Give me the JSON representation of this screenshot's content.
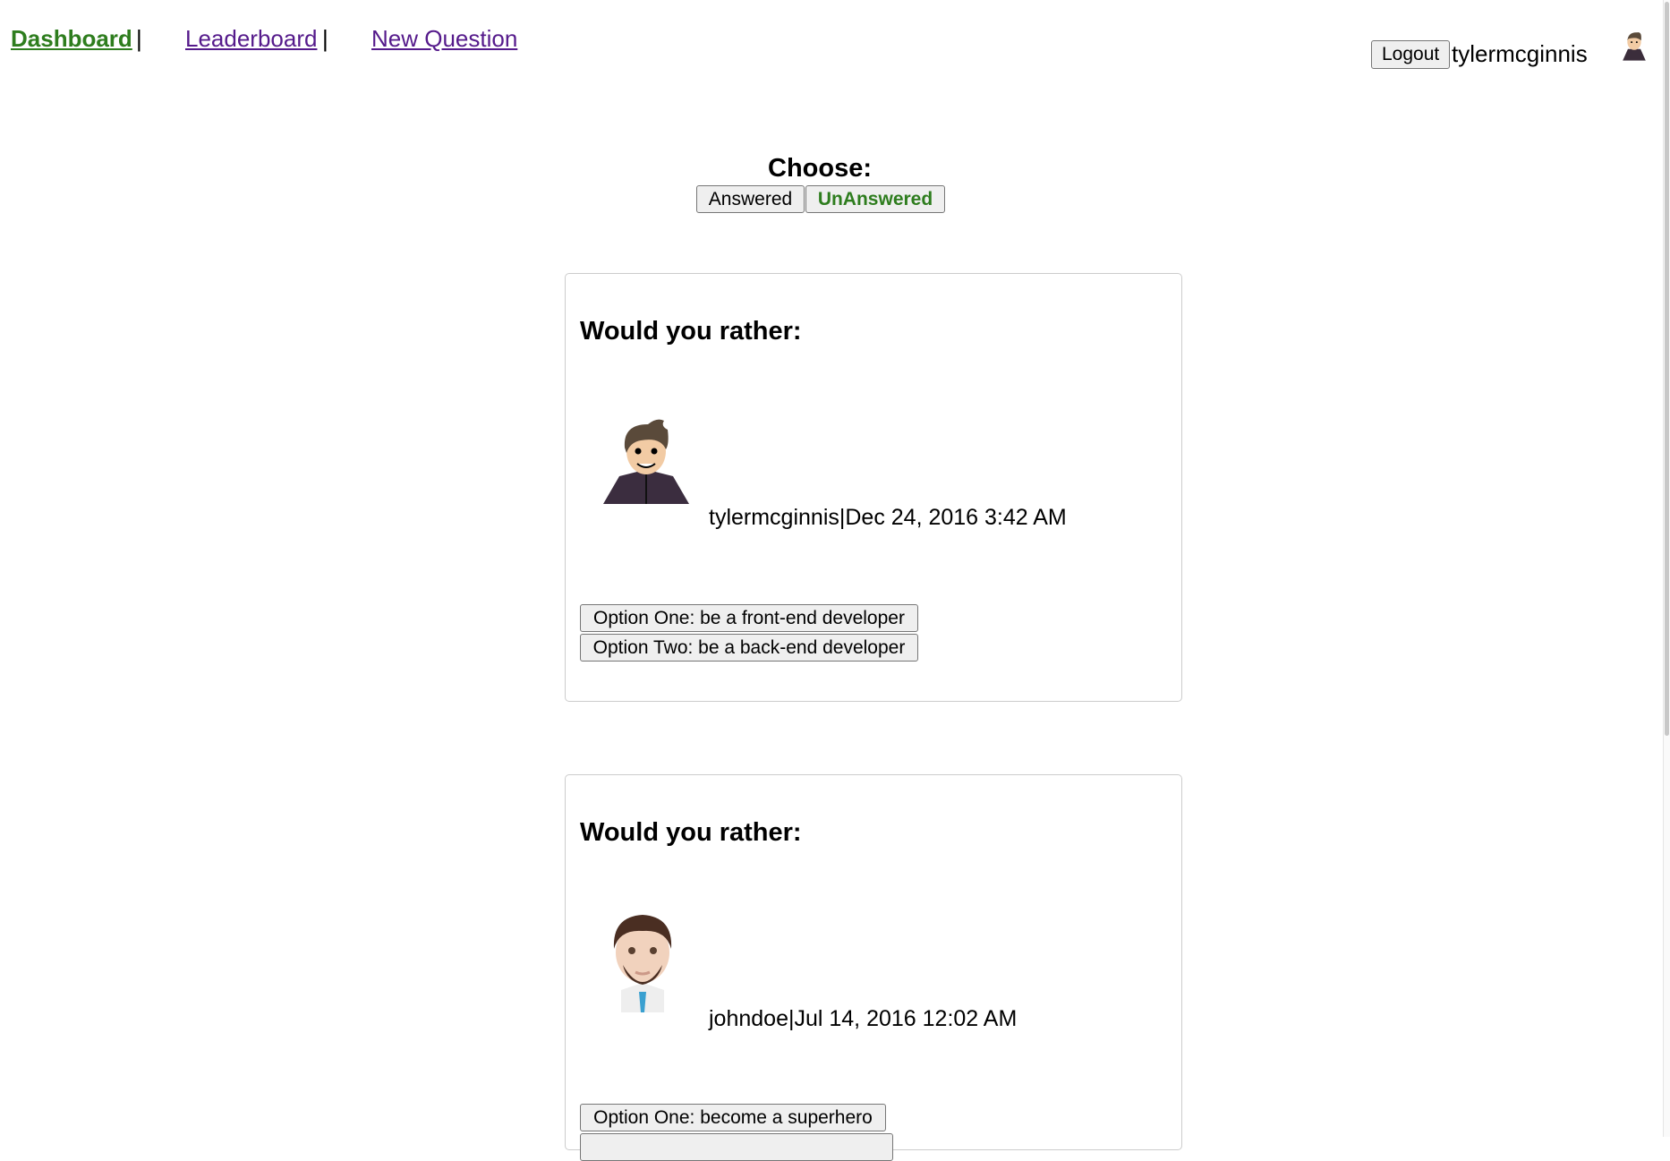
{
  "nav": {
    "links": [
      {
        "label": "Dashboard",
        "active": true
      },
      {
        "label": "Leaderboard",
        "active": false
      },
      {
        "label": "New Question",
        "active": false
      }
    ],
    "separator": "|"
  },
  "user": {
    "logout_label": "Logout",
    "username": "tylermcginnis",
    "avatar_icon": "user-avatar-icon"
  },
  "filter": {
    "heading": "Choose:",
    "answered_label": "Answered",
    "unanswered_label": "UnAnswered",
    "active": "UnAnswered"
  },
  "colors": {
    "active_link": "#2e7d1e",
    "visited_link": "#551a8b"
  },
  "questions": [
    {
      "title": "Would you rather:",
      "author": "tylermcginnis",
      "date": "Dec 24, 2016 3:42 AM",
      "byline": "tylermcginnis|Dec 24, 2016 3:42 AM",
      "option_one": "Option One: be a front-end developer",
      "option_two": "Option Two: be a back-end developer"
    },
    {
      "title": "Would you rather:",
      "author": "johndoe",
      "date": "Jul 14, 2016 12:02 AM",
      "byline": "johndoe|Jul 14, 2016 12:02 AM",
      "option_one": "Option One: become a superhero",
      "option_two": ""
    }
  ]
}
